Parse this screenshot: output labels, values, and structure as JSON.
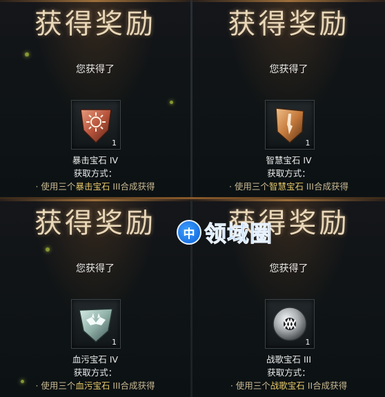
{
  "panels": [
    {
      "title": "获得奖励",
      "got_text": "您获得了",
      "count": "1",
      "gem_name": "暴击宝石 IV",
      "obtain_label": "获取方式：",
      "method_prefix": "· 使用三个",
      "method_gem": "暴击宝石",
      "method_suffix": " III合成获得",
      "gem_color": "#b8543c",
      "gem_icon": "sun-rune-gem-icon"
    },
    {
      "title": "获得奖励",
      "got_text": "您获得了",
      "count": "1",
      "gem_name": "智慧宝石 IV",
      "obtain_label": "获取方式：",
      "method_prefix": "· 使用三个",
      "method_gem": "智慧宝石",
      "method_suffix": " III合成获得",
      "gem_color": "#c57a3c",
      "gem_icon": "wisdom-gem-icon"
    },
    {
      "title": "获得奖励",
      "got_text": "您获得了",
      "count": "1",
      "gem_name": "血污宝石 IV",
      "obtain_label": "获取方式：",
      "method_prefix": "· 使用三个",
      "method_gem": "血污宝石",
      "method_suffix": " III合成获得",
      "gem_color": "#8fb0a8",
      "gem_icon": "blood-gem-icon"
    },
    {
      "title": "获得奖励",
      "got_text": "您获得了",
      "count": "1",
      "gem_name": "战歌宝石 III",
      "obtain_label": "获取方式：",
      "method_prefix": "· 使用三个",
      "method_gem": "战歌宝石",
      "method_suffix": " II合成获得",
      "gem_color": "#a9adb0",
      "gem_icon": "warsong-gem-icon"
    }
  ],
  "watermark": {
    "icon_glyph": "中",
    "text": "领域圈"
  },
  "colors": {
    "title": "#e9d7b9",
    "method_highlight": "#e7c86a",
    "watermark_blue": "#2a88f0"
  }
}
